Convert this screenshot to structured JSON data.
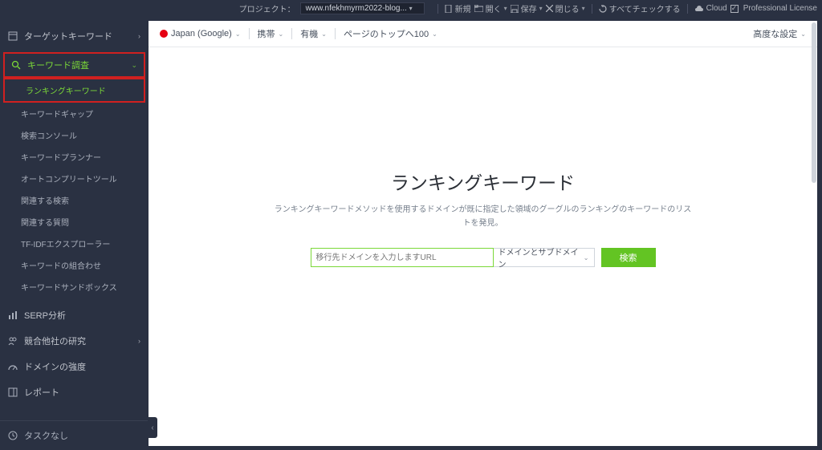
{
  "topbar": {
    "project_label": "プロジェクト：",
    "project_value": "www.nfekhmyrm2022-blog...",
    "new": "新規",
    "open": "開く",
    "save": "保存",
    "close": "閉じる",
    "check_all": "すべてチェックする",
    "cloud": "Cloud",
    "license": "Professional License"
  },
  "sidebar": {
    "target_kw": "ターゲットキーワード",
    "kw_research": "キーワード調査",
    "subs": {
      "ranking_kw": "ランキングキーワード",
      "kw_gap": "キーワードギャップ",
      "search_console": "検索コンソール",
      "kw_planner": "キーワードプランナー",
      "autocomplete": "オートコンプリートツール",
      "related_search": "関連する検索",
      "related_question": "関連する質問",
      "tfidf": "TF-IDFエクスプローラー",
      "kw_combo": "キーワードの組合わせ",
      "kw_sandbox": "キーワードサンドボックス"
    },
    "serp": "SERP分析",
    "competitor": "競合他社の研究",
    "domain_strength": "ドメインの強度",
    "report": "レポート",
    "no_task": "タスクなし"
  },
  "filters": {
    "region": "Japan (Google)",
    "device": "携帯",
    "organic": "有機",
    "top": "ページのトップへ100",
    "advanced": "高度な設定"
  },
  "main": {
    "title": "ランキングキーワード",
    "subtitle": "ランキングキーワードメソッドを使用するドメインが既に指定した領域のグーグルのランキングのキーワードのリストを発見。",
    "input_placeholder": "移行先ドメインを入力しますURL",
    "scope": "ドメインとサブドメイン",
    "search_btn": "検索"
  }
}
